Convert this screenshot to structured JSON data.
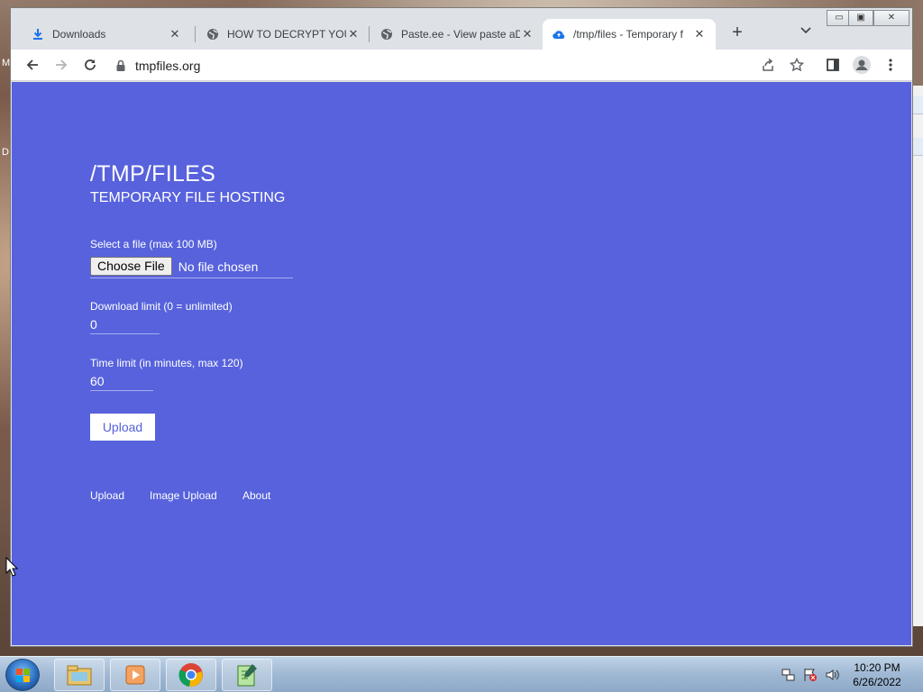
{
  "desktop": {
    "left_labels": [
      "M",
      "D"
    ]
  },
  "browser": {
    "tabs": [
      {
        "title": "Downloads",
        "icon": "download-icon",
        "active": false
      },
      {
        "title": "HOW TO DECRYPT YOUR",
        "icon": "globe-icon",
        "active": false
      },
      {
        "title": "Paste.ee - View paste aD",
        "icon": "globe-icon",
        "active": false
      },
      {
        "title": "/tmp/files - Temporary f",
        "icon": "cloud-upload-icon",
        "active": true
      }
    ],
    "new_tab_symbol": "+",
    "tab_search_symbol": "⌄",
    "window_controls": {
      "minimize": "▭",
      "maximize": "▣",
      "close": "✕"
    },
    "url": "tmpfiles.org"
  },
  "page": {
    "title": "/TMP/FILES",
    "subtitle": "TEMPORARY FILE HOSTING",
    "file_label": "Select a file (max 100 MB)",
    "choose_file_label": "Choose File",
    "no_file_text": "No file chosen",
    "download_limit_label": "Download limit (0 = unlimited)",
    "download_limit_value": "0",
    "time_limit_label": "Time limit (in minutes, max 120)",
    "time_limit_value": "60",
    "upload_button": "Upload",
    "nav": [
      "Upload",
      "Image Upload",
      "About"
    ],
    "background_color": "#5762dc"
  },
  "taskbar": {
    "apps": [
      "explorer-icon",
      "media-player-icon",
      "chrome-icon",
      "notepad-plus-icon"
    ],
    "time": "10:20 PM",
    "date": "6/26/2022"
  }
}
